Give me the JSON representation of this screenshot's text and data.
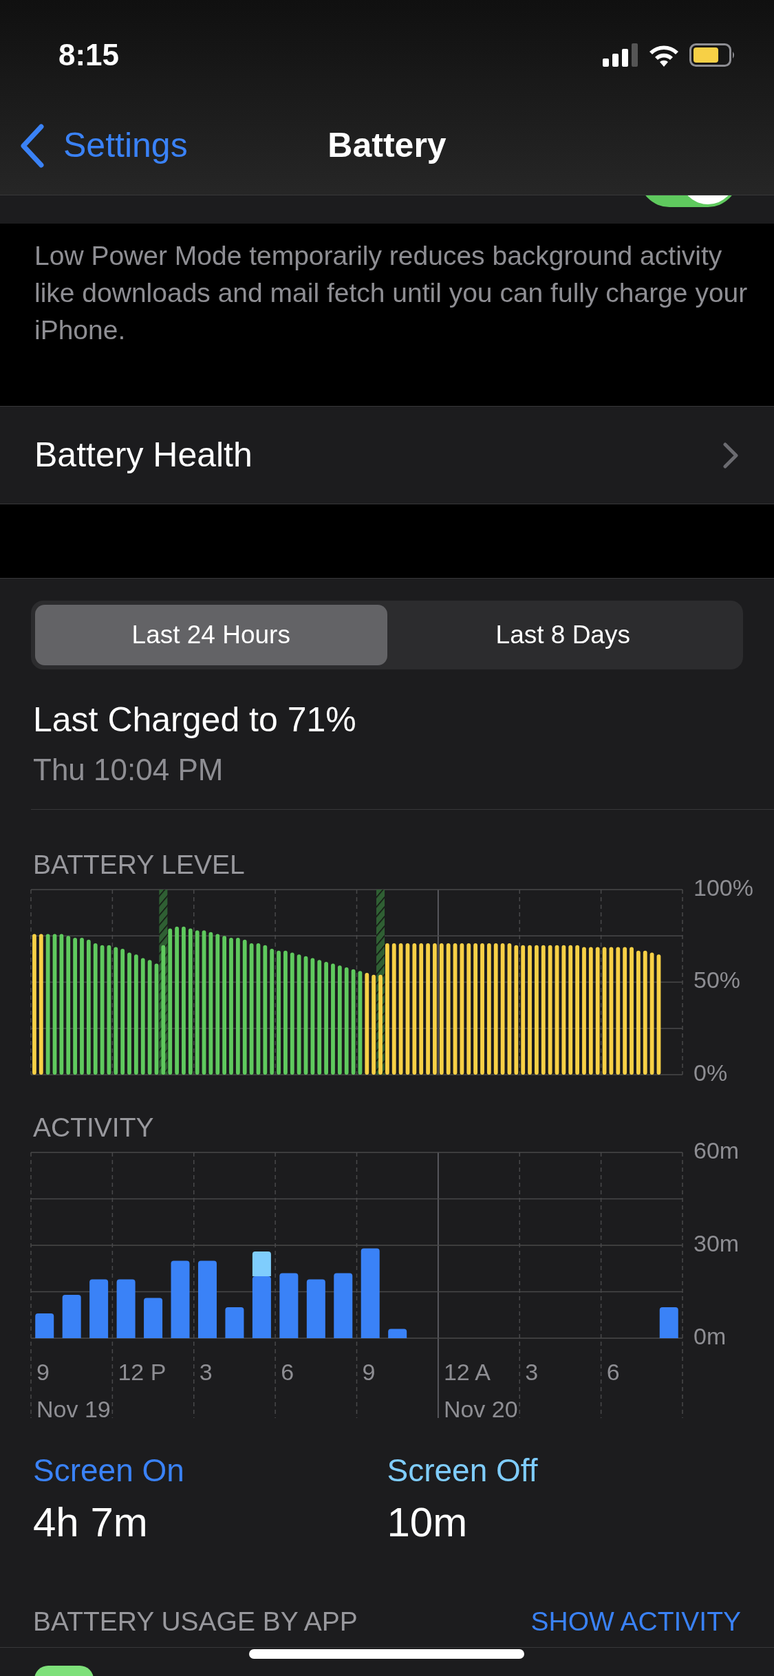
{
  "status_bar": {
    "time": "8:15"
  },
  "nav": {
    "back": "Settings",
    "title": "Battery"
  },
  "low_power_mode": {
    "on": true,
    "footer": "Low Power Mode temporarily reduces background activity like downloads and mail fetch until you can fully charge your iPhone."
  },
  "battery_health": {
    "label": "Battery Health"
  },
  "segments": [
    {
      "label": "Last 24 Hours",
      "selected": true
    },
    {
      "label": "Last 8 Days",
      "selected": false
    }
  ],
  "last_charged": {
    "title": "Last Charged to 71%",
    "time": "Thu 10:04 PM"
  },
  "battery_level": {
    "heading": "BATTERY LEVEL",
    "chart_data": {
      "type": "bar",
      "ylim": [
        0,
        100
      ],
      "yticks": [
        {
          "value": 0,
          "label": "0%"
        },
        {
          "value": 50,
          "label": "50%"
        },
        {
          "value": 100,
          "label": "100%"
        }
      ],
      "series": [
        {
          "color": "#2f5f33",
          "values": [
            null,
            null,
            null,
            null,
            null,
            null,
            null,
            null,
            null,
            null,
            null,
            null,
            null,
            null,
            null,
            null,
            null,
            null,
            null,
            100,
            null,
            null,
            null,
            null,
            null,
            null,
            null,
            null,
            null,
            null,
            null,
            null,
            null,
            null,
            null,
            null,
            null,
            null,
            null,
            null,
            null,
            null,
            null,
            null,
            null,
            null,
            null,
            null,
            null,
            null,
            null,
            100,
            null,
            null,
            null,
            null,
            null,
            null,
            null,
            null,
            null,
            null,
            null,
            null,
            null,
            null,
            null,
            null,
            null,
            null,
            null,
            null,
            null,
            null,
            null,
            null,
            null,
            null,
            null,
            null,
            null,
            null,
            null,
            null,
            null,
            null,
            null,
            null,
            null,
            null,
            null,
            null,
            null,
            null,
            null,
            null
          ]
        },
        {
          "color": "#f7d046",
          "values": [
            76,
            76,
            null,
            null,
            null,
            null,
            null,
            null,
            null,
            null,
            null,
            null,
            null,
            null,
            null,
            null,
            null,
            null,
            null,
            null,
            null,
            null,
            null,
            null,
            null,
            null,
            null,
            null,
            null,
            null,
            null,
            null,
            null,
            null,
            null,
            null,
            null,
            null,
            null,
            null,
            null,
            null,
            null,
            null,
            null,
            null,
            null,
            null,
            null,
            55,
            54,
            54,
            71,
            71,
            71,
            71,
            71,
            71,
            71,
            71,
            71,
            71,
            71,
            71,
            71,
            71,
            71,
            71,
            71,
            71,
            71,
            70,
            70,
            70,
            70,
            70,
            70,
            70,
            70,
            70,
            70,
            69,
            69,
            69,
            69,
            69,
            69,
            69,
            69,
            67,
            67,
            66,
            65,
            null,
            null,
            null
          ]
        },
        {
          "color": "#5fc95e",
          "values": [
            null,
            null,
            76,
            76,
            76,
            75,
            74,
            74,
            73,
            71,
            70,
            70,
            69,
            68,
            66,
            65,
            63,
            62,
            60,
            70,
            79,
            80,
            80,
            79,
            78,
            78,
            77,
            76,
            75,
            74,
            74,
            73,
            71,
            71,
            70,
            68,
            67,
            67,
            66,
            65,
            64,
            63,
            62,
            61,
            60,
            59,
            58,
            57,
            56,
            null,
            null,
            null,
            null,
            null,
            null,
            null,
            null,
            null,
            null,
            null,
            null,
            null,
            null,
            null,
            null,
            null,
            null,
            null,
            null,
            null,
            null,
            null,
            null,
            null,
            null,
            null,
            null,
            null,
            null,
            null,
            null,
            null,
            null,
            null,
            null,
            null,
            null,
            null,
            null,
            null,
            null,
            null,
            null,
            null,
            null,
            null
          ]
        }
      ]
    }
  },
  "activity": {
    "heading": "ACTIVITY",
    "hour_labels": [
      "9",
      "12 P",
      "3",
      "6",
      "9",
      "12 A",
      "3",
      "6"
    ],
    "date_labels": [
      "Nov 19",
      "Nov 20"
    ],
    "chart_data": {
      "type": "bar",
      "ylim": [
        0,
        60
      ],
      "yticks": [
        {
          "value": 0,
          "label": "0m"
        },
        {
          "value": 30,
          "label": "30m"
        },
        {
          "value": 60,
          "label": "60m"
        }
      ],
      "stacked": true,
      "series": [
        {
          "color": "#3a82f7",
          "values": [
            8,
            14,
            19,
            19,
            13,
            25,
            25,
            10,
            20,
            21,
            19,
            21,
            29,
            3,
            0,
            0,
            0,
            0,
            0,
            0,
            0,
            0,
            0,
            10
          ]
        },
        {
          "color": "#7fcdfd",
          "values": [
            0,
            0,
            0,
            0,
            0,
            0,
            0,
            0,
            8,
            0,
            0,
            0,
            0,
            0,
            0,
            0,
            0,
            0,
            0,
            0,
            0,
            0,
            0,
            0
          ]
        }
      ]
    }
  },
  "summary": [
    {
      "label": "Screen On",
      "value": "4h 7m",
      "color": "#3a82f7"
    },
    {
      "label": "Screen Off",
      "value": "10m",
      "color": "#7fcdfd"
    }
  ],
  "usage_by_app": {
    "heading": "BATTERY USAGE BY APP",
    "action": "SHOW ACTIVITY"
  }
}
